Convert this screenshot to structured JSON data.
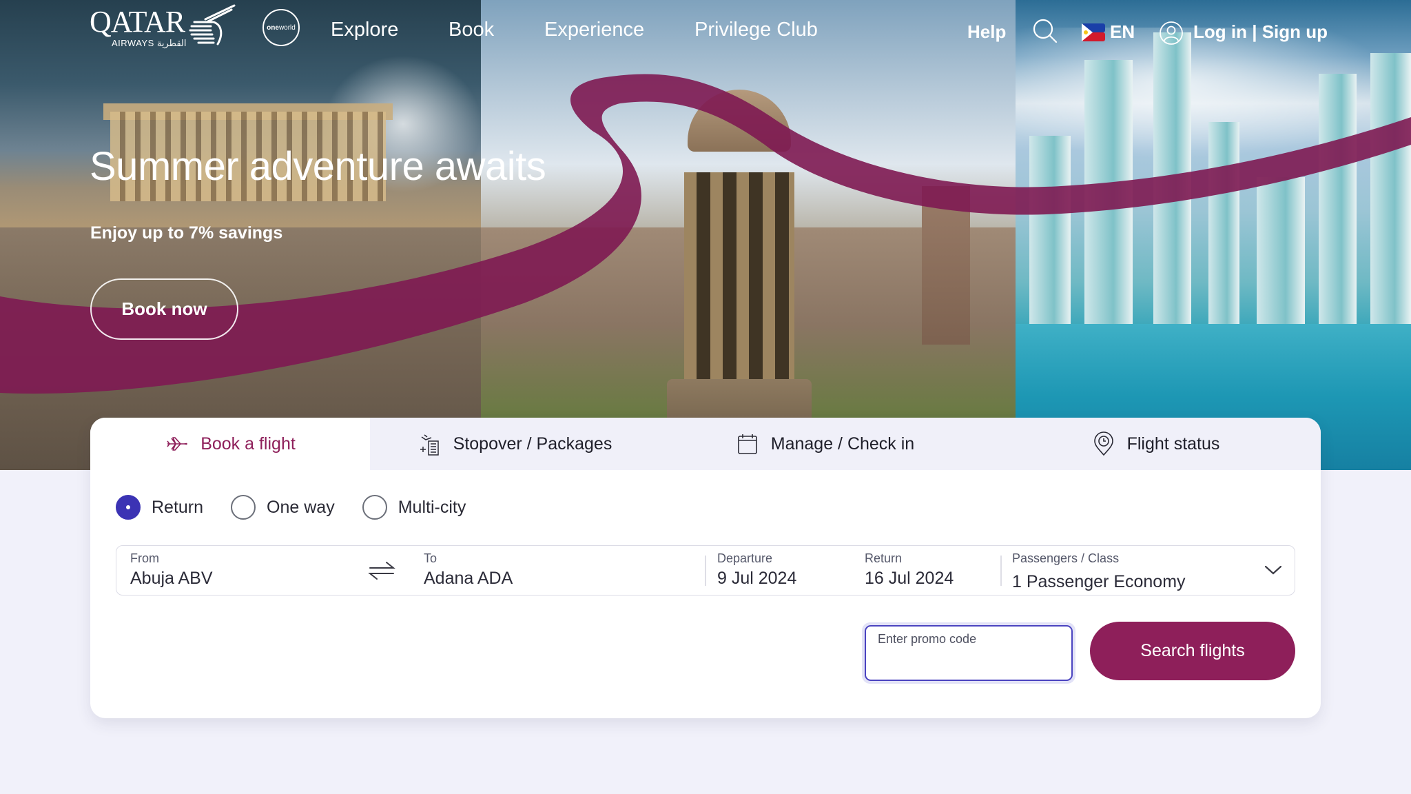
{
  "header": {
    "logo": {
      "word": "QATAR",
      "sub": "AIRWAYS القطرية"
    },
    "alliance_badge": {
      "bold": "one",
      "rest": "world"
    },
    "nav": [
      {
        "label": "Explore"
      },
      {
        "label": "Book"
      },
      {
        "label": "Experience"
      },
      {
        "label": "Privilege Club"
      }
    ],
    "help_label": "Help",
    "search_icon": "search-icon",
    "language": {
      "flag": "philippines-flag",
      "code": "EN"
    },
    "account": {
      "icon": "user-icon",
      "label": "Log in | Sign up"
    }
  },
  "hero": {
    "title": "Summer adventure awaits",
    "subtitle": "Enjoy up to 7% savings",
    "cta_label": "Book now"
  },
  "booking": {
    "tabs": [
      {
        "label": "Book a flight",
        "icon": "airplane-icon",
        "active": true
      },
      {
        "label": "Stopover / Packages",
        "icon": "stopover-hotel-icon",
        "active": false
      },
      {
        "label": "Manage / Check in",
        "icon": "calendar-icon",
        "active": false
      },
      {
        "label": "Flight status",
        "icon": "clock-pin-icon",
        "active": false
      }
    ],
    "trip_types": [
      {
        "label": "Return",
        "checked": true
      },
      {
        "label": "One way",
        "checked": false
      },
      {
        "label": "Multi-city",
        "checked": false
      }
    ],
    "from": {
      "label": "From",
      "value": "Abuja ABV"
    },
    "to": {
      "label": "To",
      "value": "Adana ADA"
    },
    "departure": {
      "label": "Departure",
      "value": "9 Jul 2024"
    },
    "return": {
      "label": "Return",
      "value": "16 Jul 2024"
    },
    "passengers": {
      "label": "Passengers / Class",
      "value": "1  Passenger Economy"
    },
    "promo": {
      "label": "Enter promo code",
      "value": ""
    },
    "search_label": "Search flights"
  },
  "colors": {
    "brand": "#8e1f5a",
    "radio_accent": "#3b33b4",
    "page_bg": "#f1f1fa",
    "tab_bg": "#f0f0f9"
  }
}
